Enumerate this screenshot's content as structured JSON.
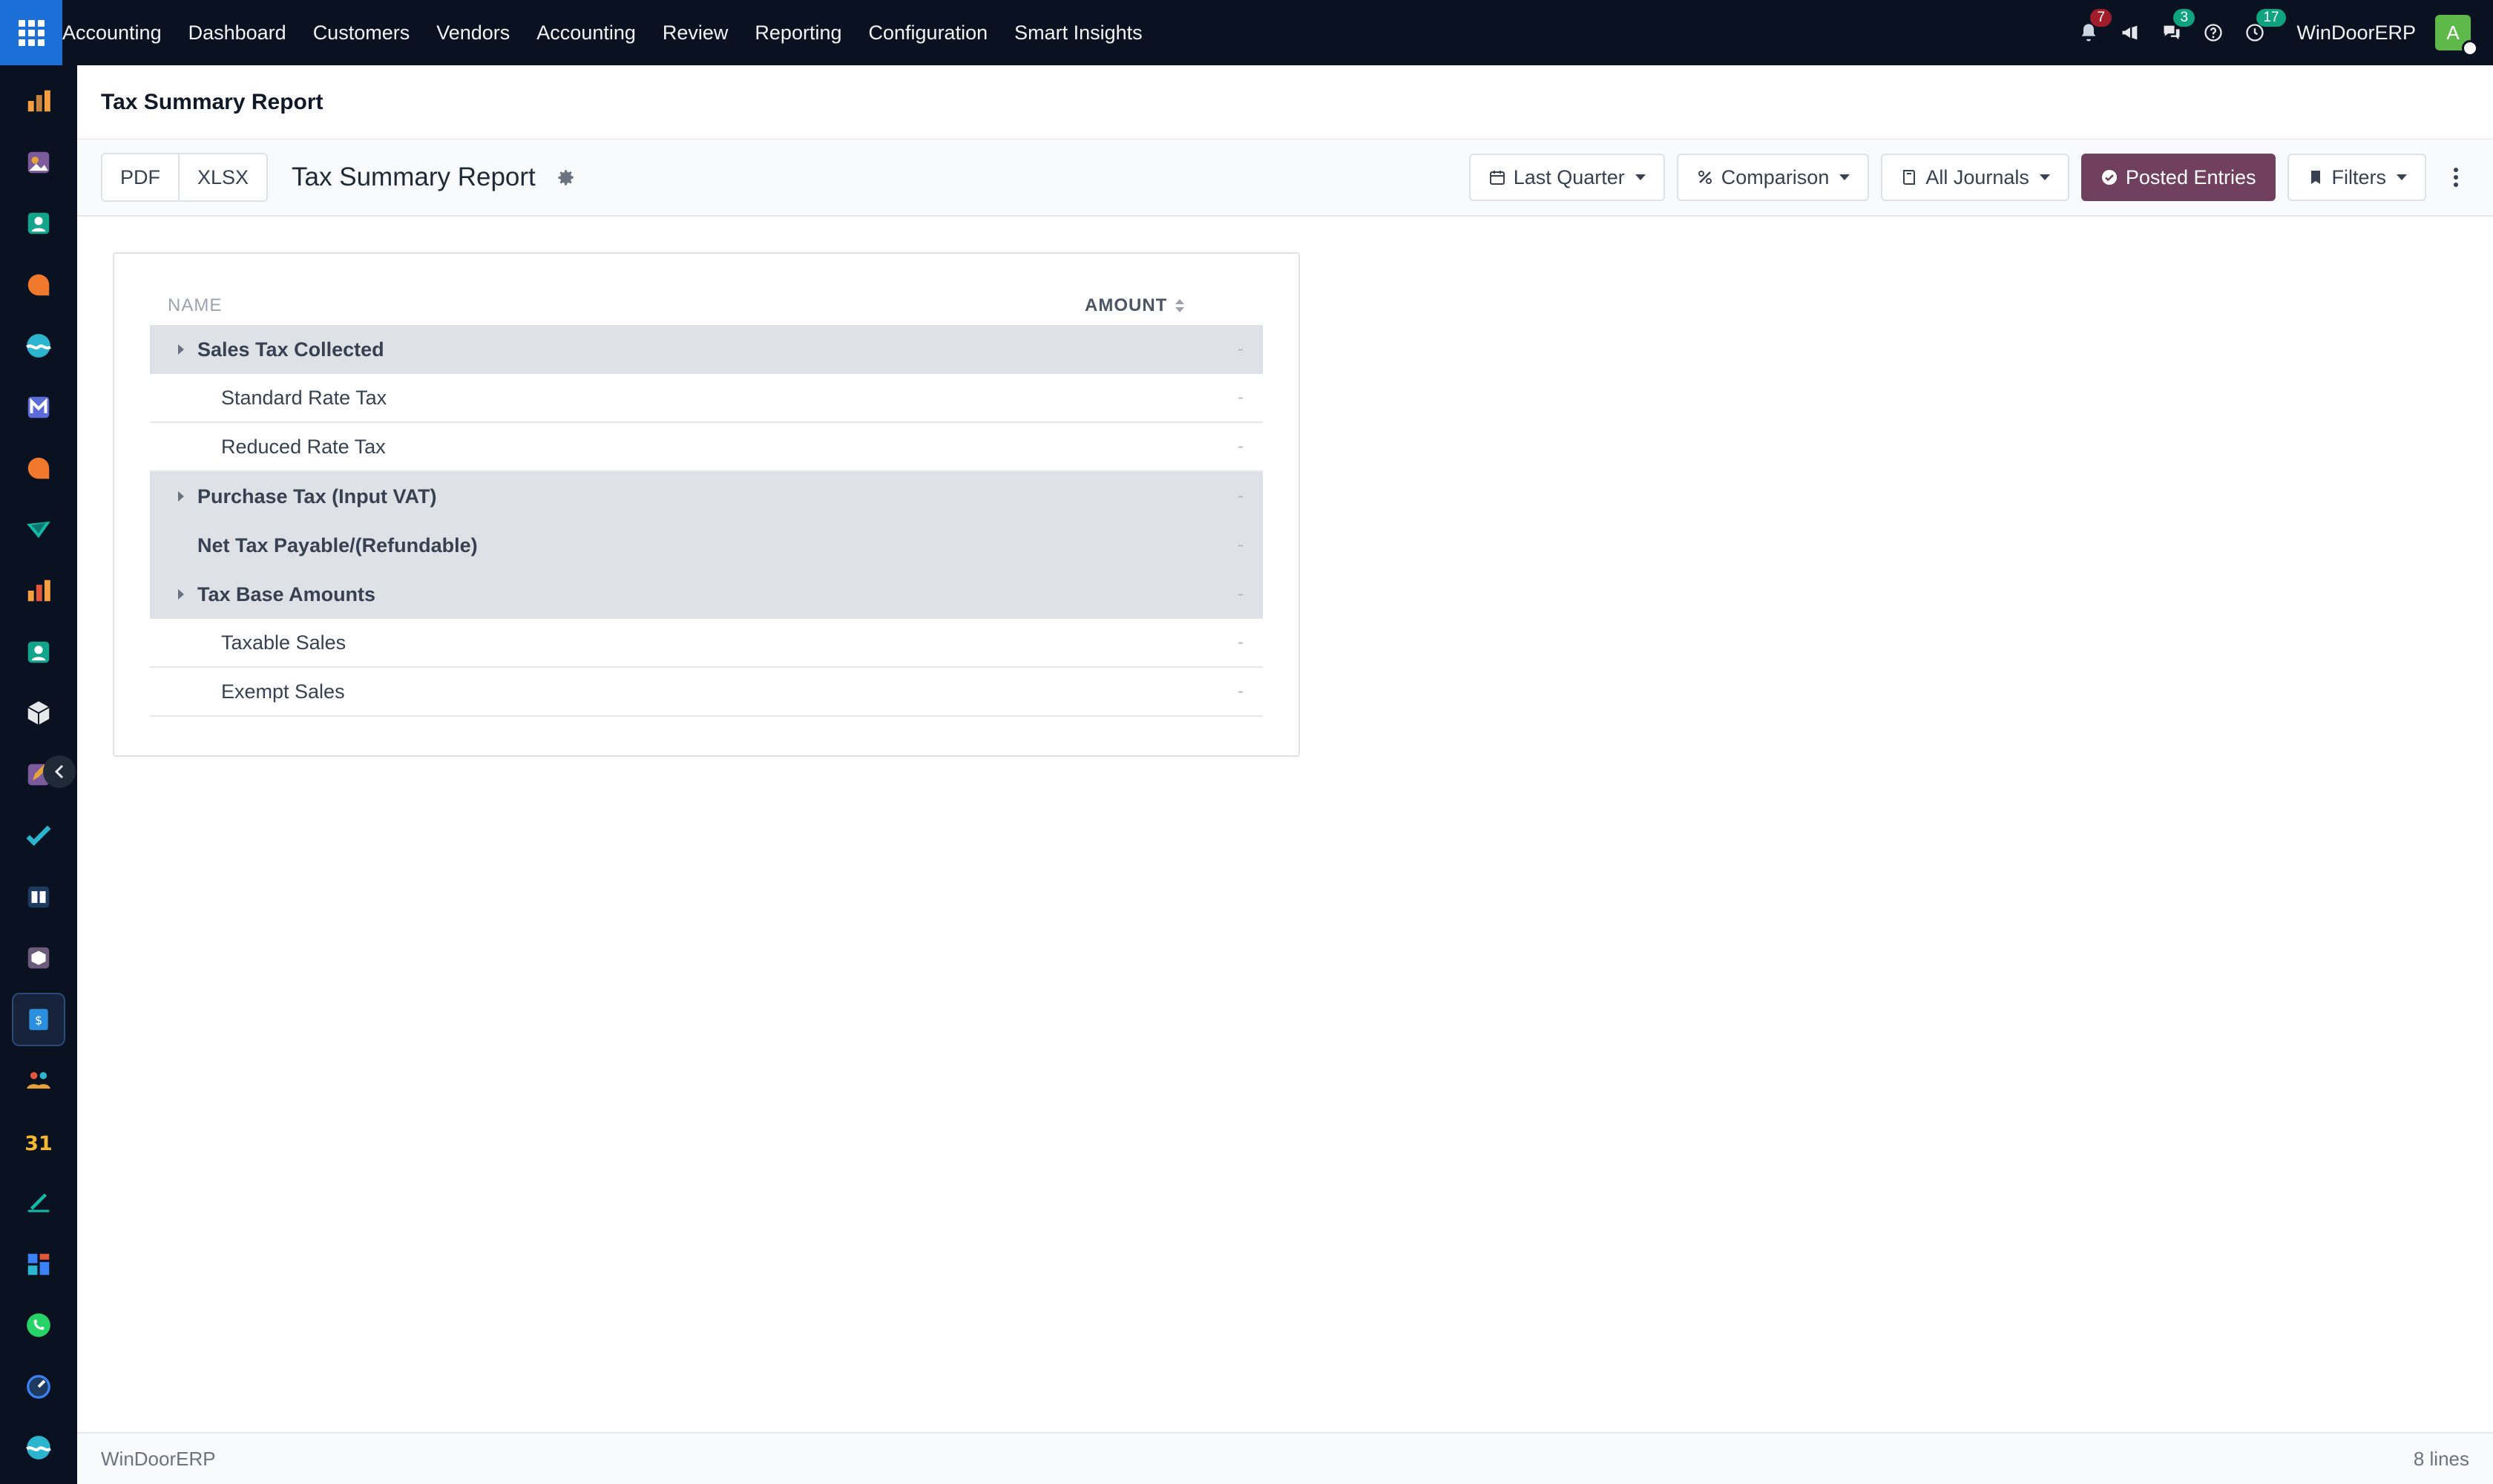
{
  "topbar": {
    "brand": "Accounting",
    "menu": [
      "Dashboard",
      "Customers",
      "Vendors",
      "Accounting",
      "Review",
      "Reporting",
      "Configuration",
      "Smart Insights"
    ],
    "notifications_count": "7",
    "messages_count": "3",
    "activities_count": "17",
    "company": "WinDoorERP",
    "avatar_letter": "A"
  },
  "sidebar": {
    "apps": [
      {
        "icon": "bar-chart-icon",
        "color": "#f59e42"
      },
      {
        "icon": "photo-app-icon",
        "color": "#e8a23b"
      },
      {
        "icon": "contacts-icon",
        "color": "#12a58c"
      },
      {
        "icon": "discuss-icon",
        "color": "#f0782c"
      },
      {
        "icon": "wave-app-icon",
        "color": "#2bb5cf"
      },
      {
        "icon": "mail-app-icon",
        "color": "#5b6cd8"
      },
      {
        "icon": "chat-app-icon",
        "color": "#f0782c"
      },
      {
        "icon": "checkmark-app-icon",
        "color": "#14b8a6"
      },
      {
        "icon": "sales-chart-icon",
        "color": "#f59e42"
      },
      {
        "icon": "employees-icon",
        "color": "#12a58c"
      },
      {
        "icon": "cube-icon",
        "color": "#e5e7eb"
      },
      {
        "icon": "pen-app-icon",
        "color": "#e8a23b"
      },
      {
        "icon": "project-check-icon",
        "color": "#2bb5cf"
      },
      {
        "icon": "knowledge-icon",
        "color": "#3b82f6"
      },
      {
        "icon": "inventory-icon",
        "color": "#9ca3af"
      },
      {
        "icon": "invoicing-icon",
        "color": "#2b8fe0"
      },
      {
        "icon": "team-icon",
        "color": "#e8a23b"
      },
      {
        "icon": "calendar-31-icon",
        "color": "#f5b82e"
      },
      {
        "icon": "sign-icon",
        "color": "#14b8a6"
      },
      {
        "icon": "dashboard-tiles-icon",
        "color": "#3b82f6"
      },
      {
        "icon": "whatsapp-icon",
        "color": "#25d366"
      },
      {
        "icon": "timer-icon",
        "color": "#3b82f6"
      },
      {
        "icon": "wave-app-icon",
        "color": "#2bb5cf"
      }
    ]
  },
  "control_panel": {
    "breadcrumb": "Tax Summary Report",
    "export_pdf": "PDF",
    "export_xlsx": "XLSX",
    "report_name": "Tax Summary Report",
    "date_filter": "Last Quarter",
    "comparison": "Comparison",
    "journals": "All Journals",
    "posted_entries": "Posted Entries",
    "filters": "Filters"
  },
  "report": {
    "col_name": "NAME",
    "col_amount": "AMOUNT",
    "rows": [
      {
        "label": "Sales Tax Collected",
        "kind": "section",
        "expandable": true,
        "amount": "-"
      },
      {
        "label": "Standard Rate Tax",
        "kind": "line",
        "amount": "-"
      },
      {
        "label": "Reduced Rate Tax",
        "kind": "line",
        "amount": "-"
      },
      {
        "label": "Purchase Tax (Input VAT)",
        "kind": "section",
        "expandable": true,
        "amount": "-"
      },
      {
        "label": "Net Tax Payable/(Refundable)",
        "kind": "section",
        "expandable": false,
        "amount": "-"
      },
      {
        "label": "Tax Base Amounts",
        "kind": "section",
        "expandable": true,
        "amount": "-"
      },
      {
        "label": "Taxable Sales",
        "kind": "line",
        "amount": "-"
      },
      {
        "label": "Exempt Sales",
        "kind": "line",
        "amount": "-"
      }
    ]
  },
  "footer": {
    "company": "WinDoorERP",
    "line_count": "8 lines"
  },
  "colors": {
    "navbar": "#0a1120",
    "apps_button": "#1b6fd6",
    "primary": "#71405e"
  }
}
